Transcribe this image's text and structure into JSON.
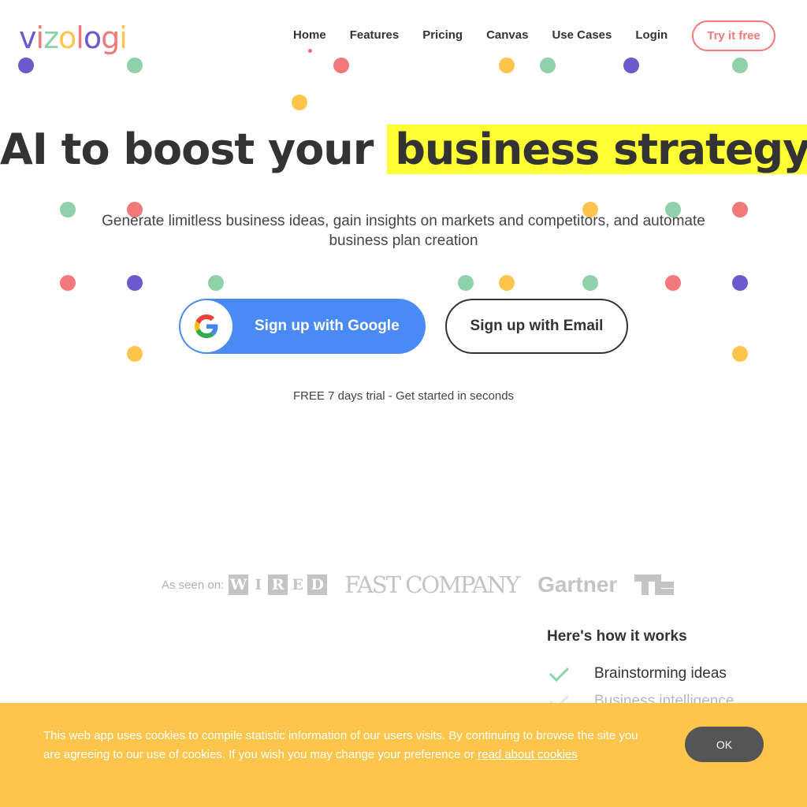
{
  "brand": {
    "logo_letters": [
      {
        "ch": "v",
        "color": "#6b5acd"
      },
      {
        "ch": "i",
        "color": "#f27979"
      },
      {
        "ch": "z",
        "color": "#8fd1aa"
      },
      {
        "ch": "o",
        "color": "#fdc54b"
      },
      {
        "ch": "l",
        "color": "#f27979"
      },
      {
        "ch": "o",
        "color": "#6b5acd"
      },
      {
        "ch": "g",
        "color": "#f27979"
      },
      {
        "ch": "i",
        "color": "#fdc54b"
      }
    ]
  },
  "nav": {
    "items": [
      {
        "label": "Home",
        "active": true
      },
      {
        "label": "Features",
        "active": false
      },
      {
        "label": "Pricing",
        "active": false
      },
      {
        "label": "Canvas",
        "active": false
      },
      {
        "label": "Use Cases",
        "active": false
      },
      {
        "label": "Login",
        "active": false
      }
    ],
    "cta_label": "Try it free"
  },
  "hero": {
    "headline_plain": "AI to boost your",
    "headline_highlight": "business strategy",
    "subtitle": "Generate limitless business ideas, gain insights on markets and competitors, and automate business plan creation",
    "google_button_label": "Sign up with Google",
    "email_button_label": "Sign up with Email",
    "trial_text": "FREE 7 days trial - Get started in seconds"
  },
  "press": {
    "label": "As seen on:",
    "logos": [
      "WIRED",
      "FASTCOMPANY",
      "Gartner",
      "TechCrunch"
    ],
    "wired_letters": [
      "W",
      "I",
      "R",
      "E",
      "D"
    ],
    "fastco_text": "FAST COMPANY",
    "gartner_text": "Gartner"
  },
  "how_it_works": {
    "title": "Here's how it works",
    "items": [
      "Brainstorming ideas",
      "Business intelligence"
    ]
  },
  "cookie_banner": {
    "text": "This web app uses cookies to compile statistic information of our users visits. By continuing to browse the site you are agreeing to our use of cookies. If you wish you may change your preference or ",
    "link_text": "read about cookies",
    "ok_label": "OK"
  },
  "colors": {
    "accent_red": "#f27979",
    "google_blue": "#4a8af4",
    "highlight_yellow": "#ffff33",
    "banner_yellow": "#fdc54b",
    "dot_purple": "#6b5acd",
    "dot_green": "#8fd1aa",
    "dot_yellow": "#fdc54b"
  }
}
